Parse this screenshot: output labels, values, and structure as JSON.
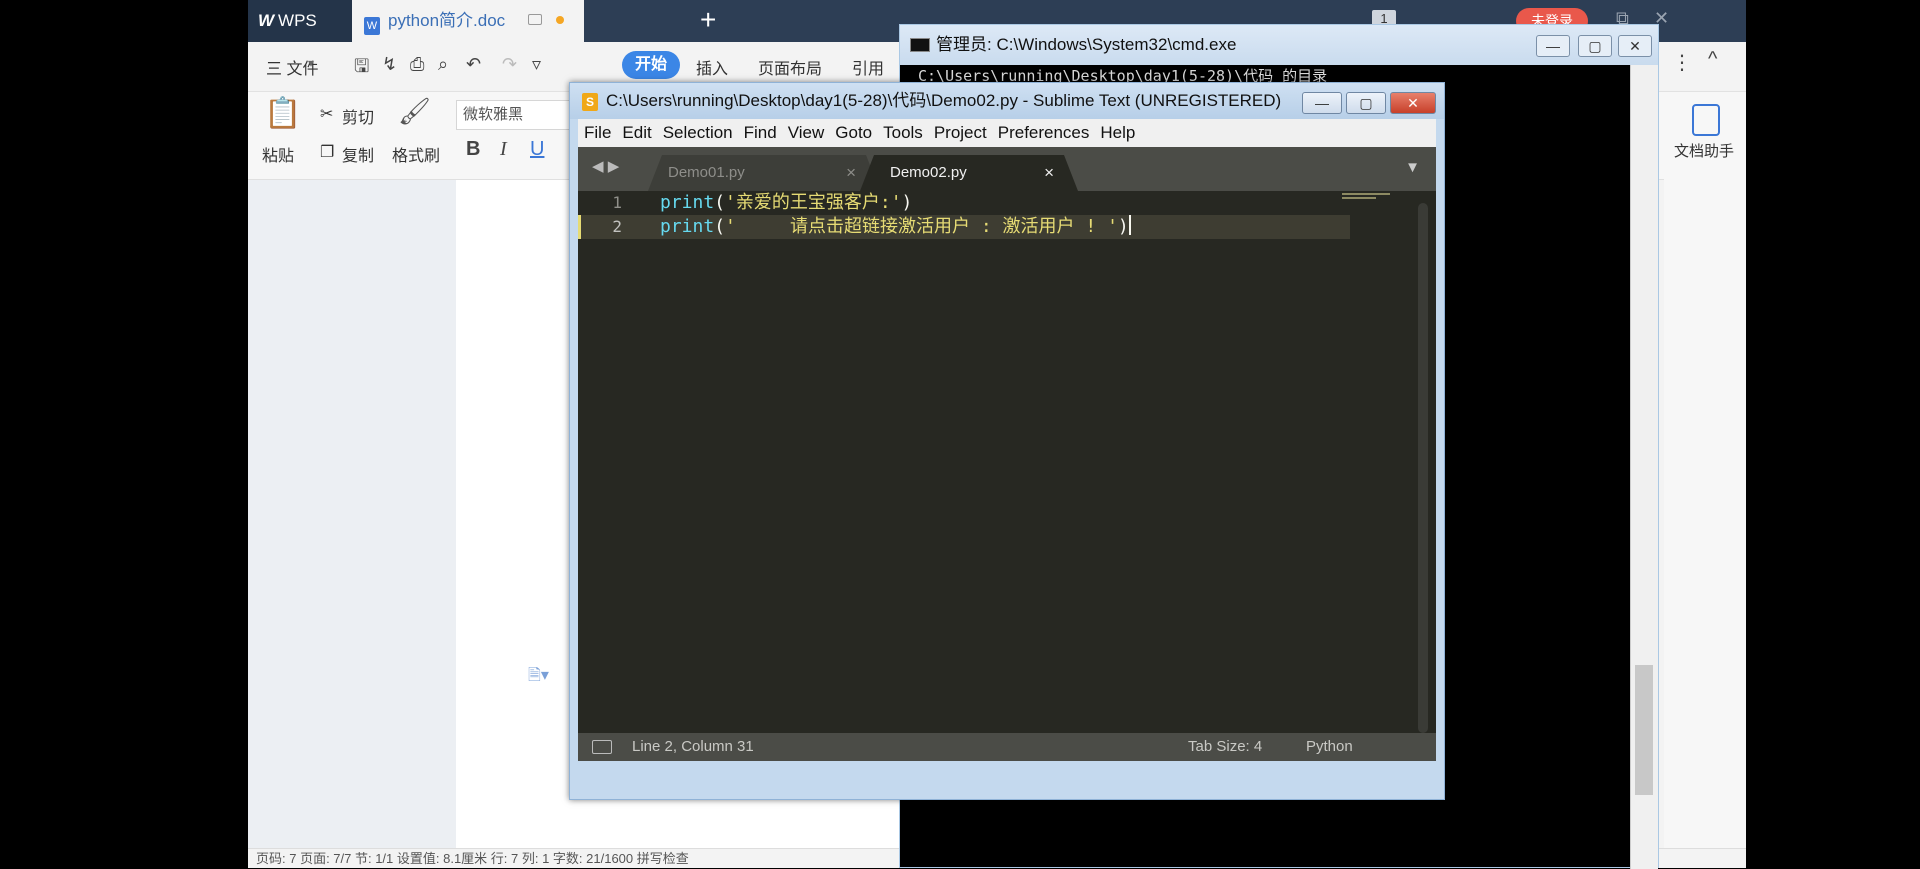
{
  "wps": {
    "app_name": "WPS",
    "doc_tab": "python简介.doc",
    "new_tab": "+",
    "badge": "1",
    "login_button": "未登录",
    "menu": {
      "file": "三 文件",
      "tabs": [
        "开始",
        "插入",
        "页面布局",
        "引用"
      ]
    },
    "ribbon": {
      "paste": "粘贴",
      "cut": "剪切",
      "copy": "复制",
      "format_painter": "格式刷",
      "font": "微软雅黑",
      "bold": "B",
      "italic": "I",
      "underline": "U",
      "doc_helper": "文档助手"
    },
    "statusbar": "页码: 7   页面: 7/7   节: 1/1   设置值: 8.1厘米   行: 7   列: 1   字数: 21/1600   拼写检查"
  },
  "cmd": {
    "title": "管理员: C:\\Windows\\System32\\cmd.exe",
    "lines": [
      "C:\\Users\\running\\Desktop\\day1(5-28)\\代码 的目录"
    ]
  },
  "sublime": {
    "title": "C:\\Users\\running\\Desktop\\day1(5-28)\\代码\\Demo02.py - Sublime Text (UNREGISTERED)",
    "menu": [
      "File",
      "Edit",
      "Selection",
      "Find",
      "View",
      "Goto",
      "Tools",
      "Project",
      "Preferences",
      "Help"
    ],
    "tabs": [
      {
        "label": "Demo01.py",
        "active": false
      },
      {
        "label": "Demo02.py",
        "active": true
      }
    ],
    "close_glyph": "×",
    "code": [
      {
        "num": "1",
        "fn": "print",
        "open": "(",
        "str": "'亲爱的王宝强客户:'",
        "close": ")"
      },
      {
        "num": "2",
        "fn": "print",
        "open": "(",
        "str": "'     请点击超链接激活用户 : 激活用户 ! '",
        "close": ")"
      }
    ],
    "status": {
      "position": "Line 2, Column 31",
      "tab_size": "Tab Size: 4",
      "syntax": "Python"
    }
  }
}
